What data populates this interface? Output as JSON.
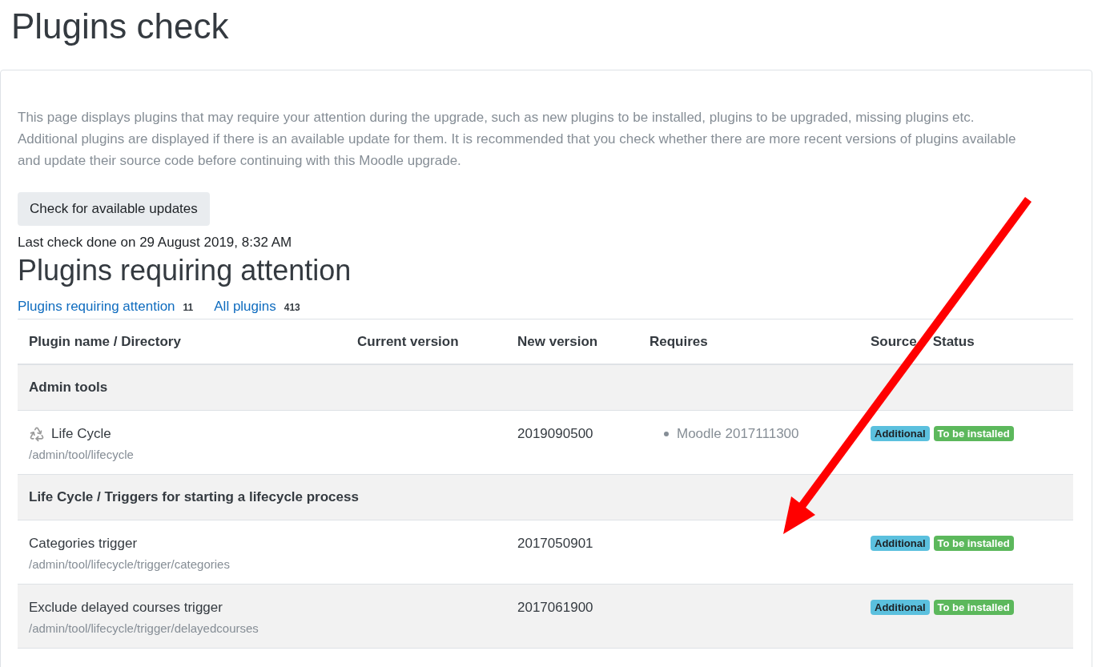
{
  "page_title": "Plugins check",
  "description": "This page displays plugins that may require your attention during the upgrade, such as new plugins to be installed, plugins to be upgraded, missing plugins etc. Additional plugins are displayed if there is an available update for them. It is recommended that you check whether there are more recent versions of plugins available and update their source code before continuing with this Moodle upgrade.",
  "check_button": "Check for available updates",
  "last_check": "Last check done on 29 August 2019, 8:32 AM",
  "section_title": "Plugins requiring attention",
  "filters": [
    {
      "label": "Plugins requiring attention",
      "count": "11"
    },
    {
      "label": "All plugins",
      "count": "413"
    }
  ],
  "table": {
    "columns": [
      "Plugin name / Directory",
      "Current version",
      "New version",
      "Requires",
      "Source",
      "Status"
    ],
    "rows": [
      {
        "kind": "group",
        "name": "Admin tools"
      },
      {
        "kind": "plugin",
        "name": "Life Cycle",
        "has_icon": true,
        "directory": "/admin/tool/lifecycle",
        "new_version": "2019090500",
        "requires": [
          "Moodle 2017111300"
        ],
        "badges": [
          {
            "kind": "info",
            "label": "Additional"
          },
          {
            "kind": "success",
            "label": "To be installed"
          }
        ]
      },
      {
        "kind": "group",
        "name": "Life Cycle / Triggers for starting a lifecycle process"
      },
      {
        "kind": "plugin",
        "name": "Categories trigger",
        "has_icon": false,
        "directory": "/admin/tool/lifecycle/trigger/categories",
        "new_version": "2017050901",
        "requires": [],
        "badges": [
          {
            "kind": "info",
            "label": "Additional"
          },
          {
            "kind": "success",
            "label": "To be installed"
          }
        ]
      },
      {
        "kind": "plugin",
        "name": "Exclude delayed courses trigger",
        "has_icon": false,
        "directory": "/admin/tool/lifecycle/trigger/delayedcourses",
        "new_version": "2017061900",
        "requires": [],
        "badges": [
          {
            "kind": "info",
            "label": "Additional"
          },
          {
            "kind": "success",
            "label": "To be installed"
          }
        ]
      }
    ]
  }
}
